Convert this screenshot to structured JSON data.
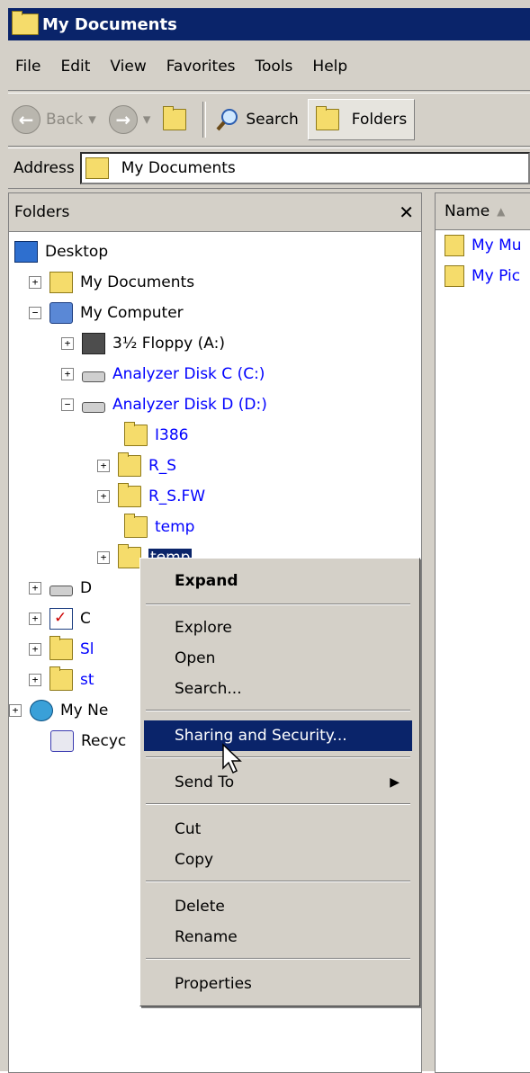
{
  "window": {
    "title": "My Documents"
  },
  "menu": [
    "File",
    "Edit",
    "View",
    "Favorites",
    "Tools",
    "Help"
  ],
  "toolbar": {
    "back_label": "Back",
    "search_label": "Search",
    "folders_label": "Folders"
  },
  "address": {
    "label": "Address",
    "value": "My Documents"
  },
  "folders_pane": {
    "title": "Folders",
    "close_glyph": "✕",
    "tree": [
      {
        "label": "Desktop"
      },
      {
        "label": "My Documents"
      },
      {
        "label": "My Computer"
      },
      {
        "label": "3½ Floppy (A:)"
      },
      {
        "label": "Analyzer Disk C (C:)"
      },
      {
        "label": "Analyzer Disk D (D:)"
      },
      {
        "label": "I386"
      },
      {
        "label": "R_S"
      },
      {
        "label": "R_S.FW"
      },
      {
        "label": "temp"
      },
      {
        "label": "temp"
      },
      {
        "label": "D"
      },
      {
        "label": "C"
      },
      {
        "label": "Sl"
      },
      {
        "label": "st"
      },
      {
        "label": "My Ne"
      },
      {
        "label": "Recyc"
      }
    ]
  },
  "list_pane": {
    "column_name": "Name",
    "items": [
      {
        "label": "My Mu"
      },
      {
        "label": "My Pic"
      }
    ]
  },
  "context_menu": {
    "items": [
      {
        "label": "Expand"
      },
      {
        "label": "Explore"
      },
      {
        "label": "Open"
      },
      {
        "label": "Search..."
      },
      {
        "label": "Sharing and Security..."
      },
      {
        "label": "Send To"
      },
      {
        "label": "Cut"
      },
      {
        "label": "Copy"
      },
      {
        "label": "Delete"
      },
      {
        "label": "Rename"
      },
      {
        "label": "Properties"
      }
    ]
  },
  "colors": {
    "titlebar": "#0a246a",
    "menu_highlight": "#0a246a",
    "link_text": "#0000ff",
    "face": "#d4d0c8"
  }
}
